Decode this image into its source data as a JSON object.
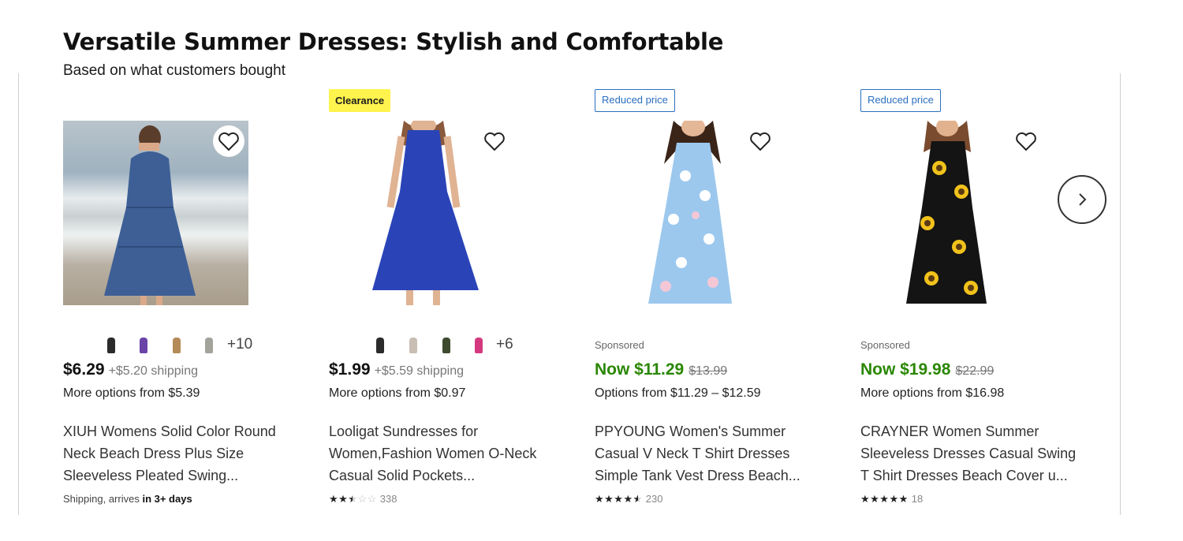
{
  "section": {
    "title": "Versatile Summer Dresses: Stylish and Comfortable",
    "subtitle": "Based on what customers bought"
  },
  "products": [
    {
      "badge": "",
      "more_colors": "+10",
      "sponsored": "",
      "price": "$6.29",
      "shipping": "+$5.20 shipping",
      "was_price": "",
      "options": "More options from $5.39",
      "name": "XIUH Womens Solid Color Round Neck Beach Dress Plus Size Sleeveless Pleated Swing...",
      "delivery_prefix": "Shipping, arrives",
      "delivery_time": "in 3+ days",
      "rating": "",
      "reviews": "",
      "dress_color": "#3d5f96"
    },
    {
      "badge": "Clearance",
      "more_colors": "+6",
      "sponsored": "",
      "price": "$1.99",
      "shipping": "+$5.59 shipping",
      "was_price": "",
      "options": "More options from $0.97",
      "name": "Looligat Sundresses for Women,Fashion Women O-Neck Casual Solid Pockets...",
      "delivery_prefix": "",
      "delivery_time": "",
      "rating": 2.5,
      "reviews": "338",
      "dress_color": "#2a44b8"
    },
    {
      "badge": "Reduced price",
      "more_colors": "",
      "sponsored": "Sponsored",
      "price": "Now $11.29",
      "shipping": "",
      "was_price": "$13.99",
      "options": "Options from $11.29 – $12.59",
      "name": "PPYOUNG Women's Summer Casual V Neck T Shirt Dresses Simple Tank Vest Dress Beach...",
      "delivery_prefix": "",
      "delivery_time": "",
      "rating": 4.5,
      "reviews": "230",
      "dress_color": "#9cc8ee"
    },
    {
      "badge": "Reduced price",
      "more_colors": "",
      "sponsored": "Sponsored",
      "price": "Now $19.98",
      "shipping": "",
      "was_price": "$22.99",
      "options": "More options from $16.98",
      "name": "CRAYNER Women Summer Sleeveless Dresses Casual Swing T Shirt Dresses Beach Cover u...",
      "delivery_prefix": "",
      "delivery_time": "",
      "rating": 5,
      "reviews": "18",
      "dress_color": "#141414"
    }
  ],
  "colors": {
    "clearance_badge": "#fff34d",
    "reduced_badge": "#2a6fbf",
    "now_price": "#2a8703"
  },
  "icons": {
    "favorite": "heart-outline-icon",
    "next": "chevron-right-icon",
    "star": "star-icon"
  }
}
